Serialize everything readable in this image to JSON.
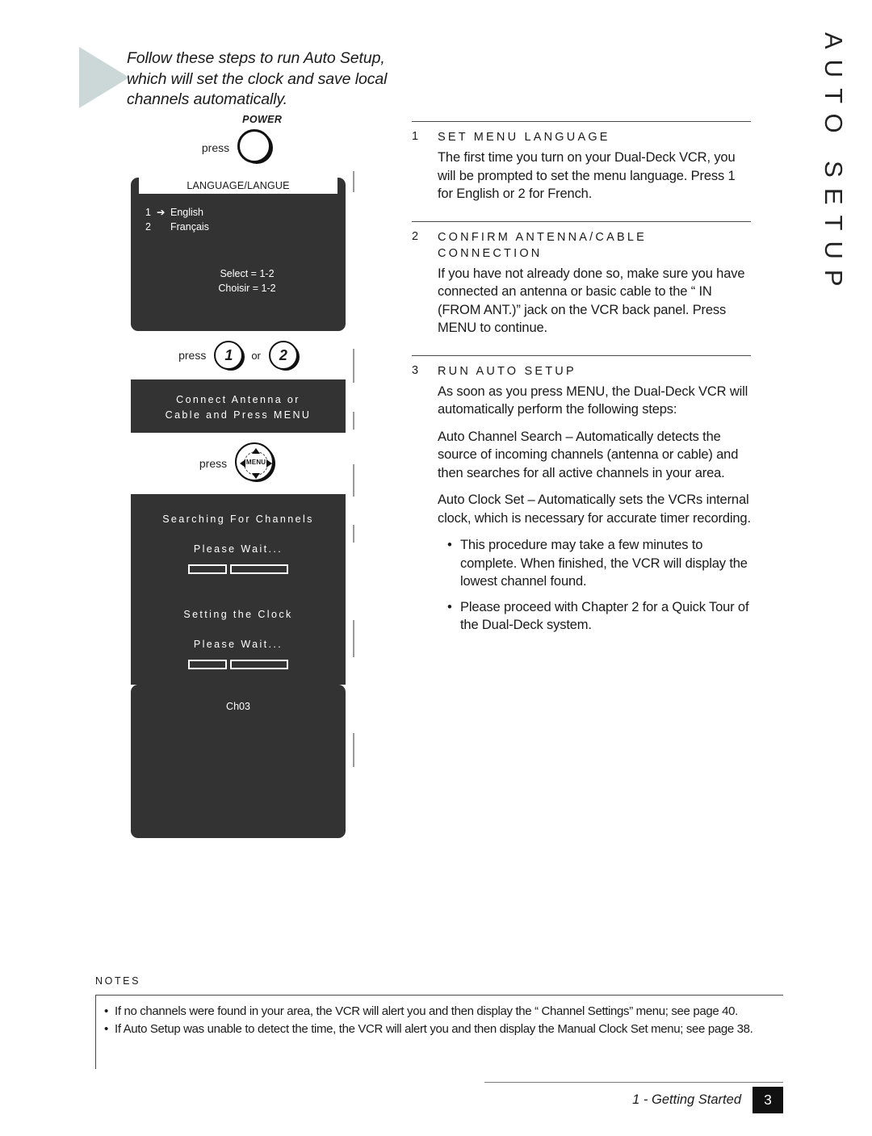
{
  "chapter_title": "AUTO SETUP",
  "intro": {
    "text": "Follow these steps to run Auto Setup, which will set the clock and save local channels automatically."
  },
  "flow": {
    "press_label": "press",
    "or_label": "or",
    "power_label": "POWER",
    "menu_label": "MENU",
    "btn_one": "1",
    "btn_two": "2",
    "language_screen": {
      "title": "LANGUAGE/LANGUE",
      "option1_num": "1",
      "option1_arrow": "➔",
      "option1_label": "English",
      "option2_num": "2",
      "option2_arrow": "",
      "option2_label": "Français",
      "select_en": "Select = 1-2",
      "select_fr": "Choisir = 1-2"
    },
    "antenna_screen": {
      "line1": "Connect Antenna or",
      "line2": "Cable and Press MENU"
    },
    "searching_screen": {
      "line1": "Searching For Channels",
      "line2": "Please Wait..."
    },
    "clock_screen": {
      "line1": "Setting the Clock",
      "line2": "Please Wait..."
    },
    "channel_screen": {
      "line1": "Ch03"
    }
  },
  "steps": [
    {
      "num": "1",
      "heading": "SET MENU LANGUAGE",
      "paragraphs": [
        "The first time you turn on your Dual-Deck VCR, you will be prompted to set the menu language. Press 1 for English or 2 for French."
      ]
    },
    {
      "num": "2",
      "heading": "CONFIRM ANTENNA/CABLE CONNECTION",
      "paragraphs": [
        "If you have not already done so, make sure you have connected an antenna or basic cable to the “ IN (FROM ANT.)” jack on the VCR back panel. Press MENU to continue."
      ]
    },
    {
      "num": "3",
      "heading": "RUN AUTO SETUP",
      "paragraphs": [
        "As soon as you press MENU, the Dual-Deck VCR will automatically perform the following steps:",
        "Auto Channel Search – Automatically detects the source of incoming channels (antenna or cable) and then searches for all active channels in your area.",
        "Auto Clock Set – Automatically sets the VCRs internal clock, which is necessary for accurate timer recording."
      ],
      "bullets": [
        "This procedure may take a few minutes to complete. When finished, the VCR will display the lowest channel found.",
        "Please proceed with Chapter 2 for a Quick Tour of the Dual-Deck system."
      ]
    }
  ],
  "notes": {
    "label": "NOTES",
    "bullet_char": "•",
    "items": [
      "If no channels were found in your area, the VCR will alert you and then display the “ Channel Settings” menu; see page 40.",
      "If Auto Setup was unable to detect the time, the VCR will alert you and then display the Manual Clock Set menu; see page 38."
    ]
  },
  "footer": {
    "text": "1 - Getting Started",
    "page": "3"
  },
  "colors": {
    "screen_bg": "#333333",
    "arrow_fill": "#ccd7d7",
    "rule": "#4a4a4a"
  }
}
